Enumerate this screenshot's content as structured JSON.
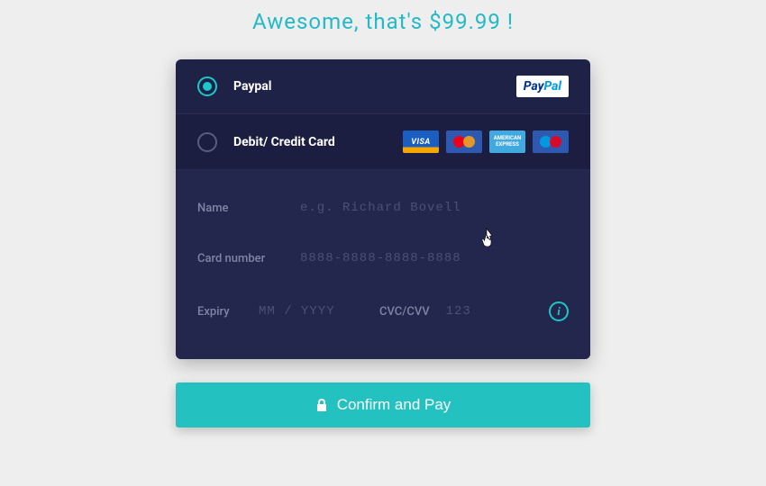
{
  "headline": "Awesome, that's $99.99 !",
  "methods": {
    "paypal": {
      "label": "Paypal",
      "brand_text": "PayPal"
    },
    "card": {
      "label": "Debit/ Credit Card"
    }
  },
  "card_badges": {
    "visa": "VISA",
    "amex": "AMERICAN EXPRESS"
  },
  "form": {
    "name": {
      "label": "Name",
      "placeholder": "e.g. Richard Bovell"
    },
    "number": {
      "label": "Card number",
      "placeholder": "8888-8888-8888-8888"
    },
    "expiry": {
      "label": "Expiry",
      "placeholder": "MM / YYYY"
    },
    "cvc": {
      "label": "CVC/CVV",
      "placeholder": "123"
    }
  },
  "confirm_label": "Confirm and Pay"
}
